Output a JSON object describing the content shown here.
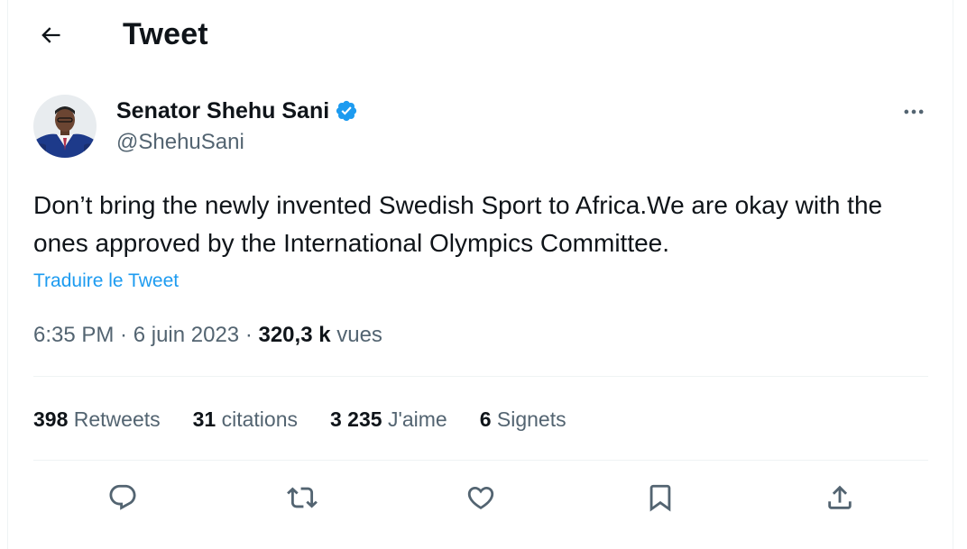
{
  "header": {
    "title": "Tweet",
    "back_icon": "arrow-left-icon"
  },
  "author": {
    "name": "Senator Shehu Sani",
    "handle": "@ShehuSani",
    "verified": true,
    "verified_color": "#1d9bf0"
  },
  "tweet": {
    "text": "Don’t bring the newly invented Swedish Sport to Africa.We are okay with the ones approved by the International Olympics Committee.",
    "translate_label": "Traduire le Tweet",
    "time": "6:35 PM",
    "separator": " · ",
    "date": "6 juin 2023",
    "views_count": "320,3 k",
    "views_label": "vues"
  },
  "stats": [
    {
      "count": "398",
      "label": "Retweets"
    },
    {
      "count": "31",
      "label": "citations"
    },
    {
      "count": "3 235",
      "label": "J'aime"
    },
    {
      "count": "6",
      "label": "Signets"
    }
  ],
  "actions": [
    {
      "icon": "reply-icon"
    },
    {
      "icon": "retweet-icon"
    },
    {
      "icon": "like-icon"
    },
    {
      "icon": "bookmark-icon"
    },
    {
      "icon": "share-icon"
    }
  ],
  "colors": {
    "text": "#0f1419",
    "secondary": "#536471",
    "link": "#1d9bf0",
    "divider": "#eff3f4"
  }
}
